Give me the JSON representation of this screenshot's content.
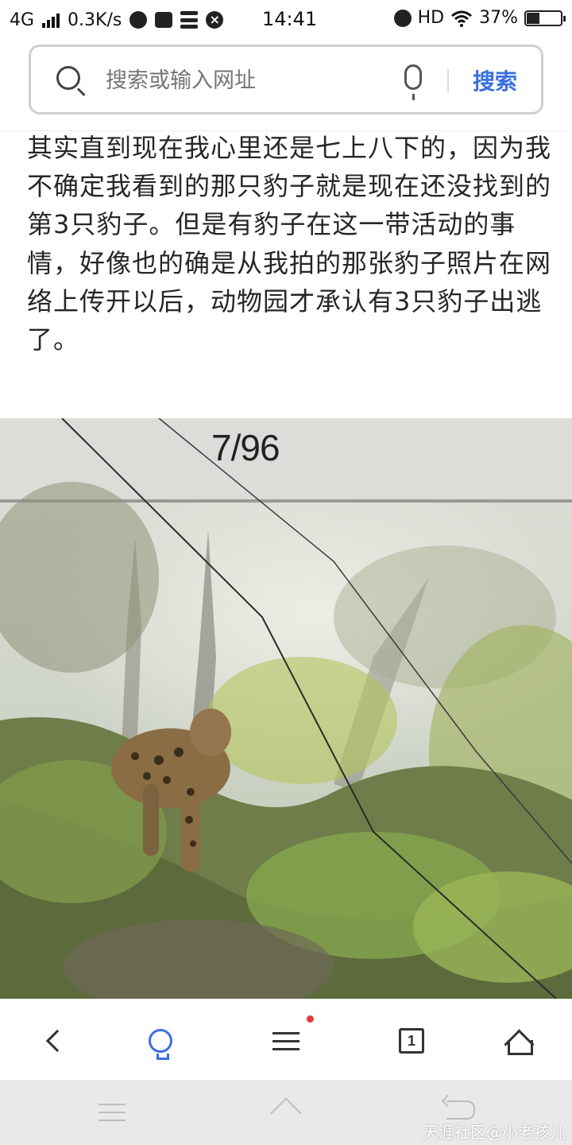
{
  "status_bar": {
    "network": "4G",
    "speed": "0.3K/s",
    "time": "14:41",
    "hd": "HD",
    "battery": "37%",
    "battery_level": 0.37
  },
  "search": {
    "placeholder": "搜索或输入网址",
    "button_label": "搜索",
    "accent_color": "#3b6fe0"
  },
  "article": {
    "text": "其实直到现在我心里还是七上八下的，因为我不确定我看到的那只豹子就是现在还没找到的第3只豹子。但是有豹子在这一带活动的事情，好像也的确是从我拍的那张豹子照片在网络上传开以后，动物园才承认有3只豹子出逃了。"
  },
  "photo": {
    "counter": "7/96",
    "subject": "leopard in forest"
  },
  "toolbar": {
    "tab_count": "1",
    "icons": [
      "back-icon",
      "lightbulb-icon",
      "menu-icon",
      "tabs-icon",
      "home-icon"
    ]
  },
  "system_nav": {
    "icons": [
      "menu-icon",
      "home-icon",
      "back-icon"
    ],
    "watermark": "天涯社区@小老孩儿"
  }
}
